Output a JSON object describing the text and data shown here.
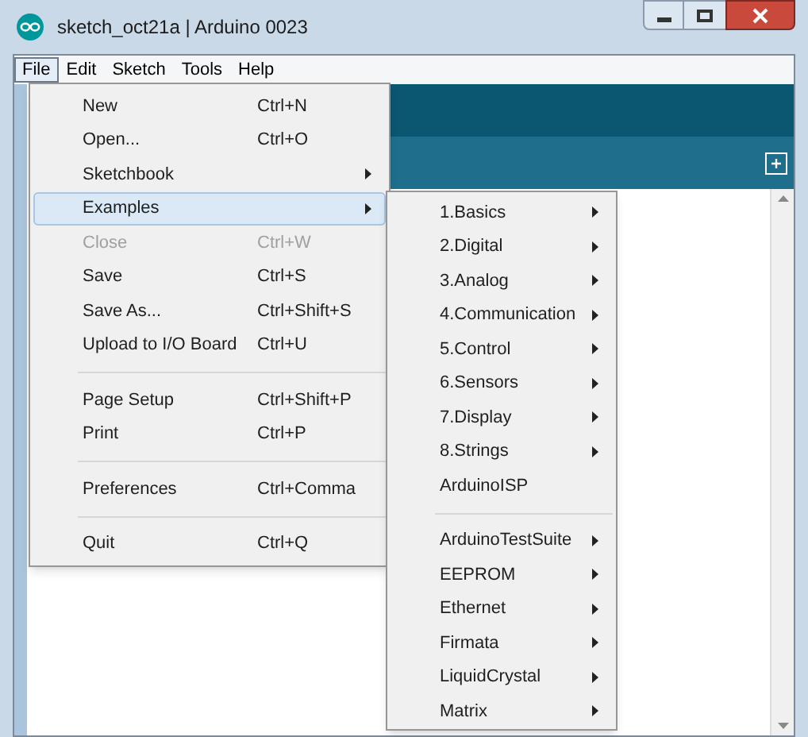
{
  "window": {
    "title": "sketch_oct21a | Arduino 0023"
  },
  "menu_bar": [
    {
      "label": "File",
      "selected": true
    },
    {
      "label": "Edit",
      "selected": false
    },
    {
      "label": "Sketch",
      "selected": false
    },
    {
      "label": "Tools",
      "selected": false
    },
    {
      "label": "Help",
      "selected": false
    }
  ],
  "file_menu": [
    {
      "kind": "item",
      "label": "New",
      "shortcut": "Ctrl+N",
      "disabled": false,
      "submenu": false,
      "selected": false
    },
    {
      "kind": "item",
      "label": "Open...",
      "shortcut": "Ctrl+O",
      "disabled": false,
      "submenu": false,
      "selected": false
    },
    {
      "kind": "item",
      "label": "Sketchbook",
      "disabled": false,
      "submenu": true,
      "selected": false
    },
    {
      "kind": "item",
      "label": "Examples",
      "disabled": false,
      "submenu": true,
      "selected": true
    },
    {
      "kind": "item",
      "label": "Close",
      "shortcut": "Ctrl+W",
      "disabled": true,
      "submenu": false,
      "selected": false
    },
    {
      "kind": "item",
      "label": "Save",
      "shortcut": "Ctrl+S",
      "disabled": false,
      "submenu": false,
      "selected": false
    },
    {
      "kind": "item",
      "label": "Save As...",
      "shortcut": "Ctrl+Shift+S",
      "disabled": false,
      "submenu": false,
      "selected": false
    },
    {
      "kind": "item",
      "label": "Upload to I/O Board",
      "shortcut": "Ctrl+U",
      "disabled": false,
      "submenu": false,
      "selected": false
    },
    {
      "kind": "separator"
    },
    {
      "kind": "item",
      "label": "Page Setup",
      "shortcut": "Ctrl+Shift+P",
      "disabled": false,
      "submenu": false,
      "selected": false
    },
    {
      "kind": "item",
      "label": "Print",
      "shortcut": "Ctrl+P",
      "disabled": false,
      "submenu": false,
      "selected": false
    },
    {
      "kind": "separator"
    },
    {
      "kind": "item",
      "label": "Preferences",
      "shortcut": "Ctrl+Comma",
      "disabled": false,
      "submenu": false,
      "selected": false
    },
    {
      "kind": "separator"
    },
    {
      "kind": "item",
      "label": "Quit",
      "shortcut": "Ctrl+Q",
      "disabled": false,
      "submenu": false,
      "selected": false
    }
  ],
  "examples_submenu": [
    {
      "kind": "item",
      "label": "1.Basics",
      "submenu": true
    },
    {
      "kind": "item",
      "label": "2.Digital",
      "submenu": true
    },
    {
      "kind": "item",
      "label": "3.Analog",
      "submenu": true
    },
    {
      "kind": "item",
      "label": "4.Communication",
      "submenu": true
    },
    {
      "kind": "item",
      "label": "5.Control",
      "submenu": true
    },
    {
      "kind": "item",
      "label": "6.Sensors",
      "submenu": true
    },
    {
      "kind": "item",
      "label": "7.Display",
      "submenu": true
    },
    {
      "kind": "item",
      "label": "8.Strings",
      "submenu": true
    },
    {
      "kind": "item",
      "label": "ArduinoISP",
      "submenu": false
    },
    {
      "kind": "separator"
    },
    {
      "kind": "item",
      "label": "ArduinoTestSuite",
      "submenu": true
    },
    {
      "kind": "item",
      "label": "EEPROM",
      "submenu": true
    },
    {
      "kind": "item",
      "label": "Ethernet",
      "submenu": true
    },
    {
      "kind": "item",
      "label": "Firmata",
      "submenu": true
    },
    {
      "kind": "item",
      "label": "LiquidCrystal",
      "submenu": true
    },
    {
      "kind": "item",
      "label": "Matrix",
      "submenu": true
    }
  ]
}
